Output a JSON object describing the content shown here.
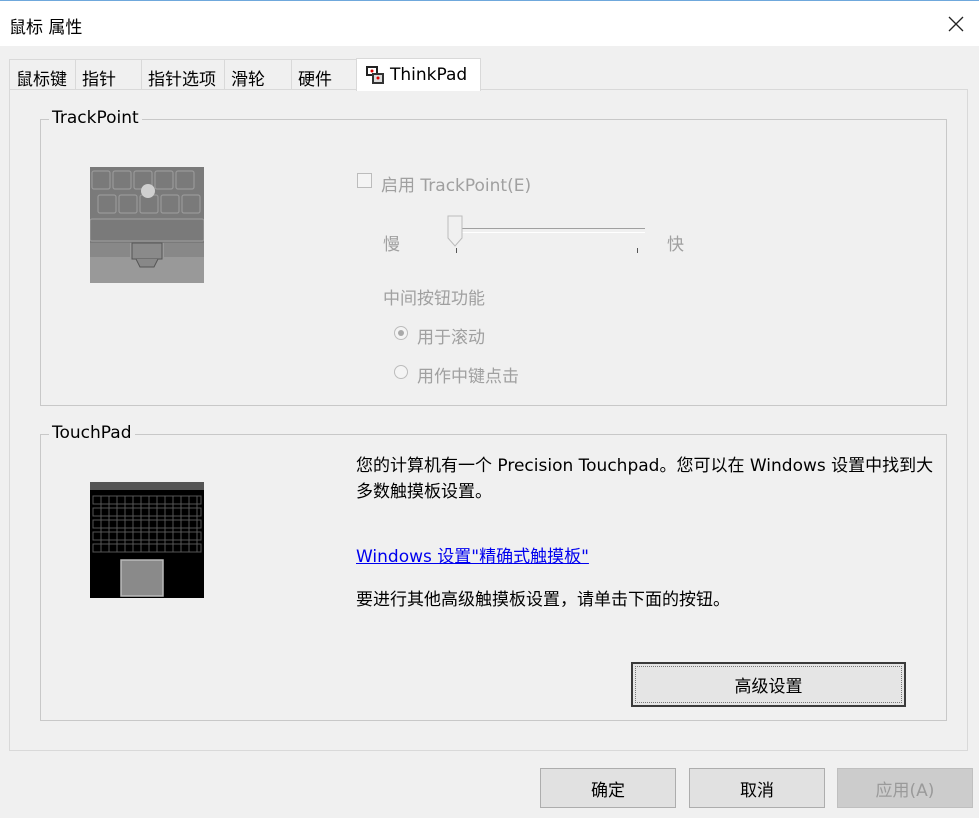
{
  "window": {
    "title": "鼠标 属性"
  },
  "tabs": [
    {
      "label": "鼠标键"
    },
    {
      "label": "指针"
    },
    {
      "label": "指针选项"
    },
    {
      "label": "滑轮"
    },
    {
      "label": "硬件"
    },
    {
      "label": "ThinkPad",
      "icon": "thinkpad-icon",
      "active": true
    }
  ],
  "trackpoint": {
    "legend": "TrackPoint",
    "enable_label": "启用 TrackPoint(E)",
    "enabled": false,
    "slider_slow": "慢",
    "slider_fast": "快",
    "slider_level": 0,
    "middle_label": "中间按钮功能",
    "options": [
      {
        "label": "用于滚动",
        "checked": true
      },
      {
        "label": "用作中键点击",
        "checked": false
      }
    ]
  },
  "touchpad": {
    "legend": "TouchPad",
    "description": "您的计算机有一个 Precision Touchpad。您可以在 Windows 设置中找到大多数触摸板设置。",
    "link": "Windows 设置\"精确式触摸板\"",
    "hint": "要进行其他高级触摸板设置，请单击下面的按钮。",
    "advanced_button": "高级设置"
  },
  "footer": {
    "ok": "确定",
    "cancel": "取消",
    "apply": "应用(A)"
  }
}
